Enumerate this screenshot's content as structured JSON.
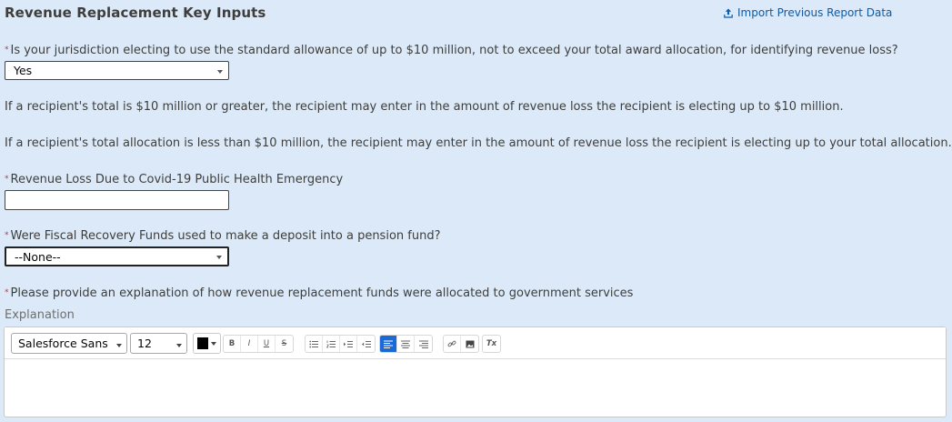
{
  "header": {
    "title": "Revenue Replacement Key Inputs",
    "import_link": "Import Previous Report Data"
  },
  "q1": {
    "required": "*",
    "label": "Is your jurisdiction electing to use the standard allowance of up to $10 million, not to exceed your total award allocation, for identifying revenue loss?",
    "value": "Yes"
  },
  "info": {
    "p1": "If a recipient's total is $10 million or greater, the recipient may enter in the amount of revenue loss the recipient is electing up to $10 million.",
    "p2": "If a recipient's total allocation is less than $10 million, the recipient may enter in the amount of revenue loss the recipient is electing up to your total allocation."
  },
  "q2": {
    "required": "*",
    "label": "Revenue Loss Due to Covid-19 Public Health Emergency",
    "value": ""
  },
  "q3": {
    "required": "*",
    "label": "Were Fiscal Recovery Funds used to make a deposit into a pension fund?",
    "value": "--None--"
  },
  "q4": {
    "required": "*",
    "label": "Please provide an explanation of how revenue replacement funds were allocated to government services",
    "sublabel": "Explanation"
  },
  "editor": {
    "font_family": "Salesforce Sans",
    "font_size": "12",
    "text_color": "#000000",
    "buttons": {
      "bold": "B",
      "italic": "I",
      "underline": "U",
      "strike": "S",
      "clear": "Tx"
    }
  },
  "colors": {
    "background": "#dbe9f8",
    "link": "#0b5cab",
    "required": "#c23934",
    "active_button": "#1b6ad6"
  }
}
